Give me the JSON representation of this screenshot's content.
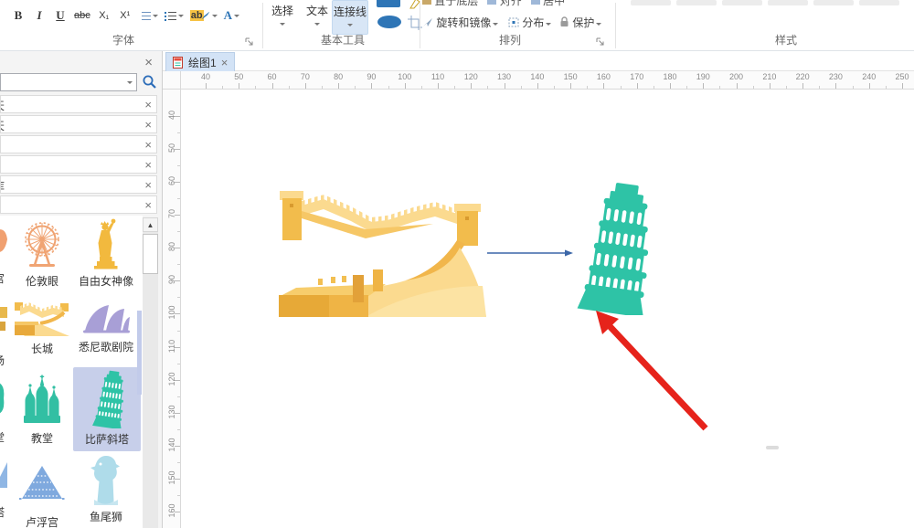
{
  "ribbon": {
    "font": {
      "label": "字体",
      "bold": "B",
      "italic": "I",
      "underline": "U",
      "strikethrough": "abc",
      "subscript": "X₁",
      "superscript": "X¹",
      "highlight_text": "ab",
      "font_color_text": "A"
    },
    "basic_tools": {
      "label": "基本工具",
      "select": "选择",
      "text": "文本",
      "connector": "连接线"
    },
    "arrange": {
      "label": "排列",
      "send_to_back": "置于底层",
      "align": "对齐",
      "center": "居中",
      "rotate_mirror": "旋转和镜像",
      "distribute": "分布",
      "protect": "保护"
    },
    "style": {
      "label": "样式"
    }
  },
  "sidebar": {
    "panels": [
      {
        "fragment": "天"
      },
      {
        "fragment": "天"
      },
      {
        "fragment": ""
      },
      {
        "fragment": ""
      },
      {
        "fragment": "库"
      },
      {
        "fragment": ""
      }
    ],
    "library": {
      "items": [
        {
          "label": "伦敦眼"
        },
        {
          "label": "自由女神像"
        },
        {
          "label": "长城"
        },
        {
          "label": "悉尼歌剧院"
        },
        {
          "label": "教堂"
        },
        {
          "label": "比萨斜塔",
          "selected": true
        },
        {
          "label": "卢浮宫"
        },
        {
          "label": "鱼尾狮"
        }
      ],
      "partial_labels": [
        "宫",
        "场",
        "堂",
        "塔"
      ]
    }
  },
  "canvas": {
    "tab": {
      "title": "绘图1"
    },
    "ruler_h": {
      "start": 40,
      "end": 250,
      "step": 10
    },
    "ruler_v": {
      "start": 40,
      "end": 160,
      "step": 10
    },
    "colors": {
      "tower_teal": "#2EC3A6",
      "wall_light": "#FBDA8F",
      "wall_mid": "#F6C766",
      "wall_gold": "#F1B64B",
      "wall_dark": "#E8A93B",
      "connector": "#3C67A8",
      "annotation_red": "#E6231B",
      "selection": "#C7CFEA"
    }
  }
}
